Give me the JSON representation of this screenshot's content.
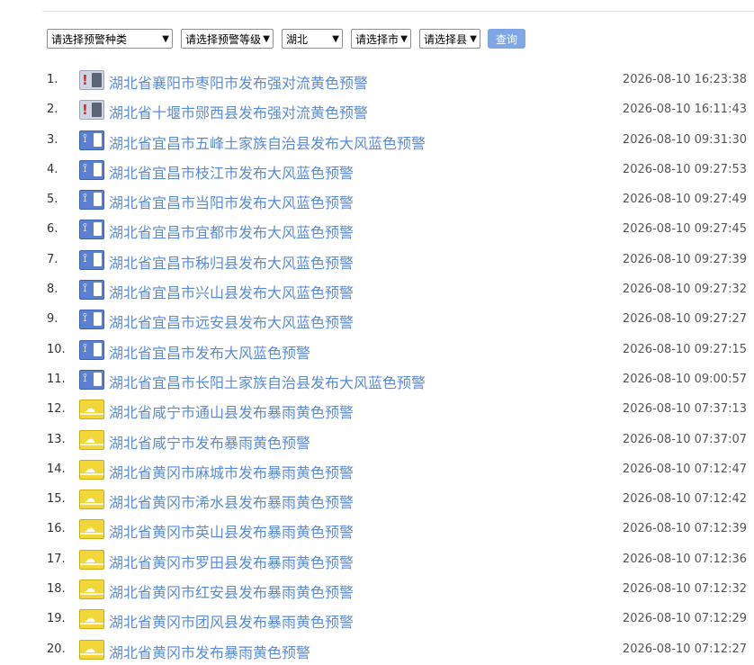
{
  "filters": {
    "type_select": "请选择预警种类",
    "level_select": "请选择预警等级",
    "province_select": "湖北",
    "city_select": "请选择市",
    "county_select": "请选择县",
    "query_button": "查询"
  },
  "warnings": [
    {
      "num": "1.",
      "icon": "storm",
      "title": "湖北省襄阳市枣阳市发布强对流黄色预警",
      "time": "2026-08-10 16:23:38"
    },
    {
      "num": "2.",
      "icon": "storm",
      "title": "湖北省十堰市郧西县发布强对流黄色预警",
      "time": "2026-08-10 16:11:43"
    },
    {
      "num": "3.",
      "icon": "wind",
      "title": "湖北省宜昌市五峰土家族自治县发布大风蓝色预警",
      "time": "2026-08-10 09:31:30"
    },
    {
      "num": "4.",
      "icon": "wind",
      "title": "湖北省宜昌市枝江市发布大风蓝色预警",
      "time": "2026-08-10 09:27:53"
    },
    {
      "num": "5.",
      "icon": "wind",
      "title": "湖北省宜昌市当阳市发布大风蓝色预警",
      "time": "2026-08-10 09:27:49"
    },
    {
      "num": "6.",
      "icon": "wind",
      "title": "湖北省宜昌市宜都市发布大风蓝色预警",
      "time": "2026-08-10 09:27:45"
    },
    {
      "num": "7.",
      "icon": "wind",
      "title": "湖北省宜昌市秭归县发布大风蓝色预警",
      "time": "2026-08-10 09:27:39"
    },
    {
      "num": "8.",
      "icon": "wind",
      "title": "湖北省宜昌市兴山县发布大风蓝色预警",
      "time": "2026-08-10 09:27:32"
    },
    {
      "num": "9.",
      "icon": "wind",
      "title": "湖北省宜昌市远安县发布大风蓝色预警",
      "time": "2026-08-10 09:27:27"
    },
    {
      "num": "10.",
      "icon": "wind",
      "title": "湖北省宜昌市发布大风蓝色预警",
      "time": "2026-08-10 09:27:15"
    },
    {
      "num": "11.",
      "icon": "wind",
      "title": "湖北省宜昌市长阳土家族自治县发布大风蓝色预警",
      "time": "2026-08-10 09:00:57"
    },
    {
      "num": "12.",
      "icon": "rain",
      "title": "湖北省咸宁市通山县发布暴雨黄色预警",
      "time": "2026-08-10 07:37:13"
    },
    {
      "num": "13.",
      "icon": "rain",
      "title": "湖北省咸宁市发布暴雨黄色预警",
      "time": "2026-08-10 07:37:07"
    },
    {
      "num": "14.",
      "icon": "rain",
      "title": "湖北省黄冈市麻城市发布暴雨黄色预警",
      "time": "2026-08-10 07:12:47"
    },
    {
      "num": "15.",
      "icon": "rain",
      "title": "湖北省黄冈市浠水县发布暴雨黄色预警",
      "time": "2026-08-10 07:12:42"
    },
    {
      "num": "16.",
      "icon": "rain",
      "title": "湖北省黄冈市英山县发布暴雨黄色预警",
      "time": "2026-08-10 07:12:39"
    },
    {
      "num": "17.",
      "icon": "rain",
      "title": "湖北省黄冈市罗田县发布暴雨黄色预警",
      "time": "2026-08-10 07:12:36"
    },
    {
      "num": "18.",
      "icon": "rain",
      "title": "湖北省黄冈市红安县发布暴雨黄色预警",
      "time": "2026-08-10 07:12:32"
    },
    {
      "num": "19.",
      "icon": "rain",
      "title": "湖北省黄冈市团风县发布暴雨黄色预警",
      "time": "2026-08-10 07:12:29"
    },
    {
      "num": "20.",
      "icon": "rain",
      "title": "湖北省黄冈市发布暴雨黄色预警",
      "time": "2026-08-10 07:12:27"
    }
  ],
  "colors": {
    "link": "#5b8bd6",
    "button": "#7fa7e6",
    "wind_blue": "#5b7fd1",
    "rain_yellow": "#f2d73b"
  }
}
